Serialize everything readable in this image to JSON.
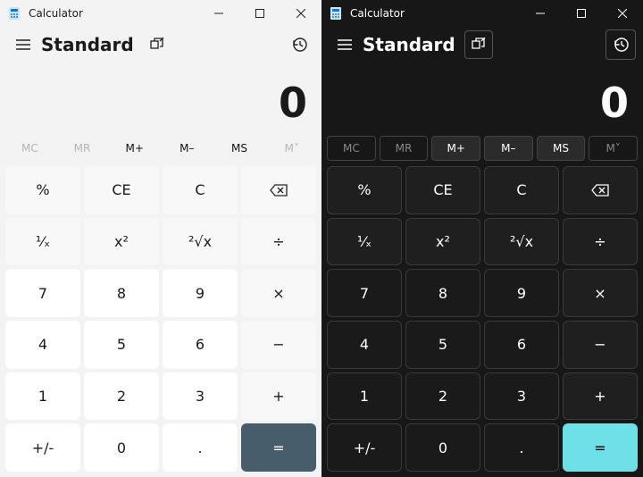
{
  "app": {
    "title": "Calculator"
  },
  "mode": {
    "label": "Standard"
  },
  "display": {
    "value": "0"
  },
  "memory": {
    "mc": {
      "label": "MC",
      "enabled": false
    },
    "mr": {
      "label": "MR",
      "enabled": false
    },
    "mplus": {
      "label": "M+",
      "enabled": true
    },
    "mmin": {
      "label": "M–",
      "enabled": true
    },
    "ms": {
      "label": "MS",
      "enabled": true
    },
    "mv": {
      "label": "M˅",
      "enabled": false
    }
  },
  "keys": {
    "percent": "%",
    "ce": "CE",
    "c": "C",
    "recip": "¹⁄ₓ",
    "sq": "x²",
    "sqrt": "²√x",
    "div": "÷",
    "n7": "7",
    "n8": "8",
    "n9": "9",
    "mul": "×",
    "n4": "4",
    "n5": "5",
    "n6": "6",
    "sub": "−",
    "n1": "1",
    "n2": "2",
    "n3": "3",
    "add": "+",
    "neg": "+/-",
    "n0": "0",
    "dot": ".",
    "eq": "="
  },
  "colors": {
    "light_bg": "#f3f3f3",
    "dark_bg": "#171717",
    "light_eq": "#485d6b",
    "dark_eq": "#6fe0e6"
  }
}
